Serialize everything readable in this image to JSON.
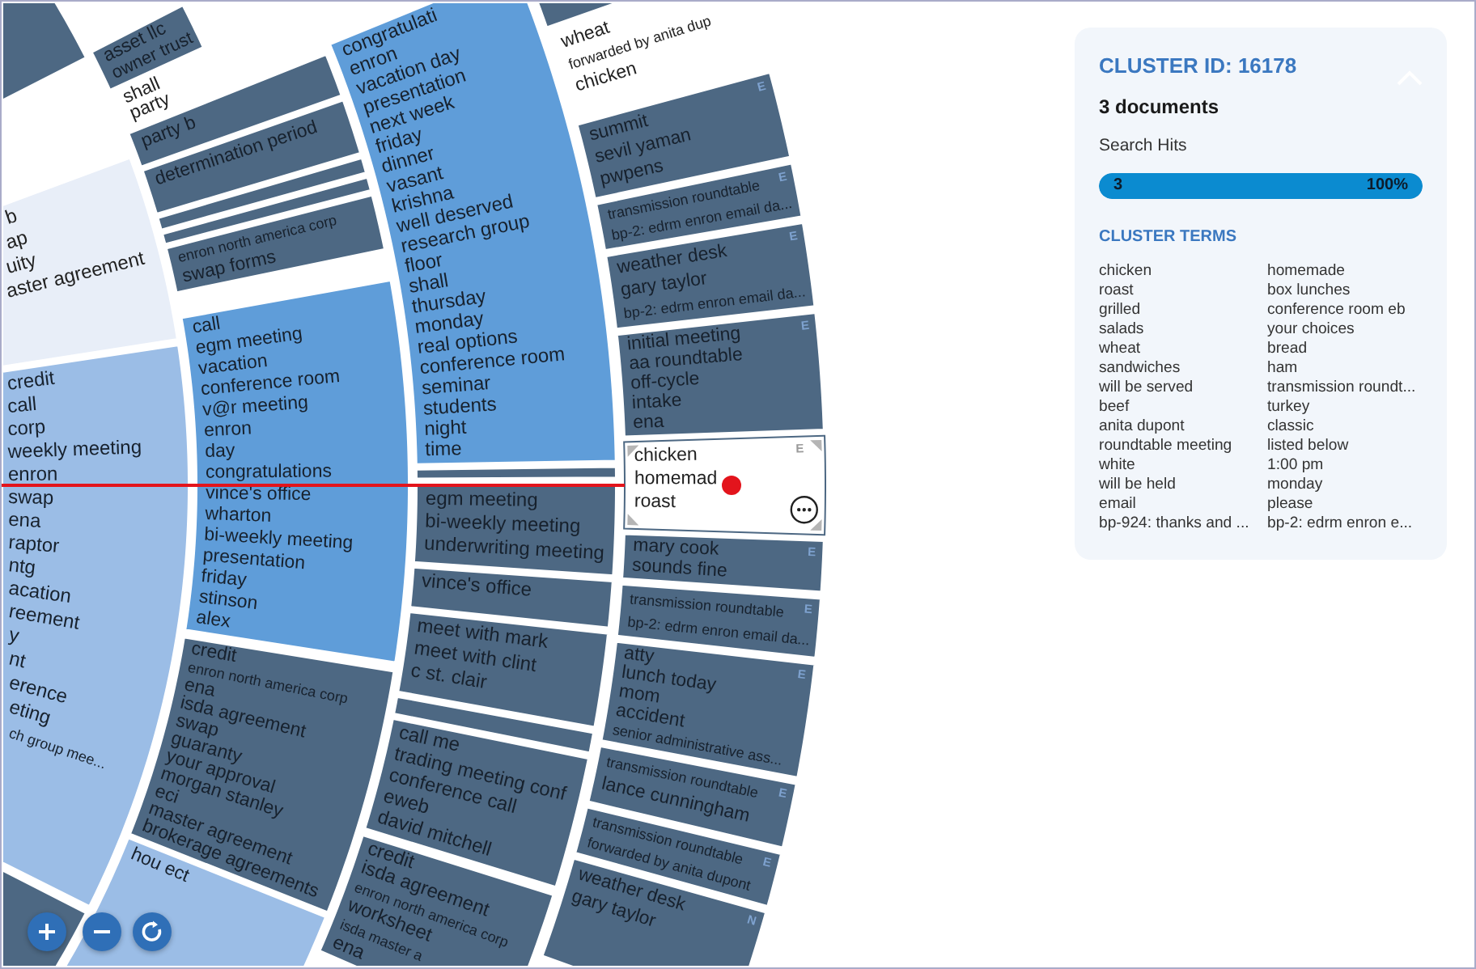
{
  "chart": {
    "rings": [
      {
        "segments": [
          {
            "kind": "dark",
            "selected": false
          },
          {
            "kind": "pale",
            "selected": false,
            "terms": [
              {
                "text": "b",
                "kind": "major"
              },
              {
                "text": "ap",
                "kind": "major"
              },
              {
                "text": "uity",
                "kind": "major"
              },
              {
                "text": "aster agreement",
                "kind": "major"
              }
            ]
          },
          {
            "kind": "light",
            "selected": false,
            "terms": [
              {
                "text": "credit",
                "kind": "major"
              },
              {
                "text": "call",
                "kind": "major"
              },
              {
                "text": "corp",
                "kind": "major"
              },
              {
                "text": "weekly meeting",
                "kind": "major"
              },
              {
                "text": "enron",
                "kind": "major"
              },
              {
                "text": "swap",
                "kind": "major"
              },
              {
                "text": "ena",
                "kind": "major"
              },
              {
                "text": "raptor",
                "kind": "major"
              },
              {
                "text": "ntg",
                "kind": "major"
              },
              {
                "text": "acation",
                "kind": "major"
              },
              {
                "text": "reement",
                "kind": "major"
              },
              {
                "text": "y",
                "kind": "major"
              },
              {
                "text": "nt",
                "kind": "major"
              },
              {
                "text": "erence",
                "kind": "major"
              },
              {
                "text": "eting",
                "kind": "major"
              },
              {
                "text": "ch group mee...",
                "kind": "minor"
              }
            ]
          },
          {
            "kind": "dark",
            "selected": false
          }
        ]
      },
      {
        "segments": [
          {
            "kind": "dark",
            "selected": false,
            "terms": [
              {
                "text": "asset llc",
                "kind": "major"
              },
              {
                "text": "owner trust",
                "kind": "major"
              }
            ]
          },
          {
            "kind": "blank",
            "selected": false,
            "terms": [
              {
                "text": "shall",
                "kind": "major"
              },
              {
                "text": "party",
                "kind": "major"
              }
            ]
          },
          {
            "kind": "dark",
            "selected": false,
            "terms": [
              {
                "text": "party b",
                "kind": "major"
              }
            ]
          },
          {
            "kind": "dark",
            "selected": false,
            "terms": [
              {
                "text": "determination period",
                "kind": "major"
              }
            ]
          },
          {
            "kind": "dark",
            "selected": false
          },
          {
            "kind": "dark",
            "selected": false
          },
          {
            "kind": "dark",
            "selected": false,
            "terms": [
              {
                "text": "enron north america corp",
                "kind": "minor"
              },
              {
                "text": "swap forms",
                "kind": "major"
              }
            ]
          },
          {
            "kind": "medium",
            "selected": false,
            "terms": [
              {
                "text": "call",
                "kind": "major"
              },
              {
                "text": "egm meeting",
                "kind": "major"
              },
              {
                "text": "vacation",
                "kind": "major"
              },
              {
                "text": "conference room",
                "kind": "major"
              },
              {
                "text": "v@r meeting",
                "kind": "major"
              },
              {
                "text": "enron",
                "kind": "major"
              },
              {
                "text": "day",
                "kind": "major"
              },
              {
                "text": "congratulations",
                "kind": "major"
              },
              {
                "text": "vince's office",
                "kind": "major"
              },
              {
                "text": "wharton",
                "kind": "major"
              },
              {
                "text": "bi-weekly meeting",
                "kind": "major"
              },
              {
                "text": "presentation",
                "kind": "major"
              },
              {
                "text": "friday",
                "kind": "major"
              },
              {
                "text": "stinson",
                "kind": "major"
              },
              {
                "text": "alex",
                "kind": "major"
              }
            ]
          },
          {
            "kind": "dark",
            "selected": false,
            "terms": [
              {
                "text": "credit",
                "kind": "major"
              },
              {
                "text": "enron north america corp",
                "kind": "minor"
              },
              {
                "text": "ena",
                "kind": "major"
              },
              {
                "text": "isda agreement",
                "kind": "major"
              },
              {
                "text": "swap",
                "kind": "major"
              },
              {
                "text": "guaranty",
                "kind": "major"
              },
              {
                "text": "your approval",
                "kind": "major"
              },
              {
                "text": "morgan stanley",
                "kind": "major"
              },
              {
                "text": "eci",
                "kind": "major"
              },
              {
                "text": "master agreement",
                "kind": "major"
              },
              {
                "text": "brokerage agreements",
                "kind": "major"
              }
            ]
          },
          {
            "kind": "light",
            "selected": false,
            "terms": [
              {
                "text": "hou ect",
                "kind": "major"
              }
            ]
          }
        ]
      },
      {
        "segments": [
          {
            "kind": "medium",
            "selected": false,
            "terms": [
              {
                "text": "congratulati",
                "kind": "major"
              },
              {
                "text": "enron",
                "kind": "major"
              },
              {
                "text": "vacation day",
                "kind": "major"
              },
              {
                "text": "presentation",
                "kind": "major"
              },
              {
                "text": "next week",
                "kind": "major"
              },
              {
                "text": "friday",
                "kind": "major"
              },
              {
                "text": "dinner",
                "kind": "major"
              },
              {
                "text": "vasant",
                "kind": "major"
              },
              {
                "text": "krishna",
                "kind": "major"
              },
              {
                "text": "well deserved",
                "kind": "major"
              },
              {
                "text": "research group",
                "kind": "major"
              },
              {
                "text": "floor",
                "kind": "major"
              },
              {
                "text": "shall",
                "kind": "major"
              },
              {
                "text": "thursday",
                "kind": "major"
              },
              {
                "text": "monday",
                "kind": "major"
              },
              {
                "text": "real options",
                "kind": "major"
              },
              {
                "text": "conference room",
                "kind": "major"
              },
              {
                "text": "seminar",
                "kind": "major"
              },
              {
                "text": "students",
                "kind": "major"
              },
              {
                "text": "night",
                "kind": "major"
              },
              {
                "text": "time",
                "kind": "major"
              }
            ]
          },
          {
            "kind": "dark",
            "selected": false
          },
          {
            "kind": "dark",
            "selected": false,
            "terms": [
              {
                "text": "egm meeting",
                "kind": "major"
              },
              {
                "text": "bi-weekly meeting",
                "kind": "major"
              },
              {
                "text": "underwriting meeting",
                "kind": "major"
              }
            ]
          },
          {
            "kind": "dark",
            "selected": false,
            "terms": [
              {
                "text": "vince's office",
                "kind": "major"
              }
            ]
          },
          {
            "kind": "dark",
            "selected": false,
            "terms": [
              {
                "text": "meet with mark",
                "kind": "major"
              },
              {
                "text": "meet with clint",
                "kind": "major"
              },
              {
                "text": "c st. clair",
                "kind": "major"
              }
            ]
          },
          {
            "kind": "dark",
            "selected": false
          },
          {
            "kind": "dark",
            "selected": false,
            "terms": [
              {
                "text": "call me",
                "kind": "major"
              },
              {
                "text": "trading meeting conf",
                "kind": "major"
              },
              {
                "text": "conference call",
                "kind": "major"
              },
              {
                "text": "eweb",
                "kind": "major"
              },
              {
                "text": "david mitchell",
                "kind": "major"
              }
            ]
          },
          {
            "kind": "dark",
            "selected": false,
            "terms": [
              {
                "text": "credit",
                "kind": "major"
              },
              {
                "text": "isda agreement",
                "kind": "major"
              },
              {
                "text": "enron north america corp",
                "kind": "minor"
              },
              {
                "text": "worksheet",
                "kind": "major"
              },
              {
                "text": "isda master a",
                "kind": "minor"
              },
              {
                "text": "ena",
                "kind": "major"
              }
            ]
          }
        ]
      },
      {
        "segments": [
          {
            "kind": "dark",
            "selected": false
          },
          {
            "kind": "blank",
            "selected": false,
            "terms": [
              {
                "text": "wheat",
                "kind": "major"
              },
              {
                "text": "forwarded by anita dup",
                "kind": "minor"
              },
              {
                "text": "chicken",
                "kind": "major"
              }
            ]
          },
          {
            "kind": "dark",
            "selected": false,
            "flag": "E",
            "terms": [
              {
                "text": "summit",
                "kind": "major"
              },
              {
                "text": "sevil yaman",
                "kind": "major"
              },
              {
                "text": "pwpens",
                "kind": "major"
              }
            ]
          },
          {
            "kind": "dark",
            "selected": false,
            "flag": "E",
            "terms": [
              {
                "text": "transmission roundtable",
                "kind": "minor"
              },
              {
                "text": "bp-2: edrm enron email da...",
                "kind": "minor"
              }
            ]
          },
          {
            "kind": "dark",
            "selected": false,
            "flag": "E",
            "terms": [
              {
                "text": "weather desk",
                "kind": "major"
              },
              {
                "text": "gary taylor",
                "kind": "major"
              },
              {
                "text": "bp-2: edrm enron email da...",
                "kind": "minor"
              }
            ]
          },
          {
            "kind": "dark",
            "selected": false,
            "flag": "E",
            "terms": [
              {
                "text": "initial meeting",
                "kind": "major"
              },
              {
                "text": "aa roundtable",
                "kind": "major"
              },
              {
                "text": "off-cycle",
                "kind": "major"
              },
              {
                "text": "intake",
                "kind": "major"
              },
              {
                "text": "ena",
                "kind": "major"
              }
            ]
          },
          {
            "kind": "dark",
            "selected": true,
            "flag": "E",
            "terms": [
              {
                "text": "chicken",
                "kind": "major"
              },
              {
                "text": "homemad",
                "kind": "major"
              },
              {
                "text": "roast",
                "kind": "major"
              }
            ]
          },
          {
            "kind": "dark",
            "selected": false,
            "flag": "E",
            "terms": [
              {
                "text": "mary cook",
                "kind": "major"
              },
              {
                "text": "sounds fine",
                "kind": "major"
              }
            ]
          },
          {
            "kind": "dark",
            "selected": false,
            "flag": "E",
            "terms": [
              {
                "text": "transmission roundtable",
                "kind": "minor"
              },
              {
                "text": "bp-2: edrm enron email da...",
                "kind": "minor"
              }
            ]
          },
          {
            "kind": "dark",
            "selected": false,
            "flag": "E",
            "terms": [
              {
                "text": "atty",
                "kind": "major"
              },
              {
                "text": "lunch today",
                "kind": "major"
              },
              {
                "text": "mom",
                "kind": "major"
              },
              {
                "text": "accident",
                "kind": "major"
              },
              {
                "text": "senior administrative ass...",
                "kind": "minor"
              }
            ]
          },
          {
            "kind": "dark",
            "selected": false,
            "flag": "E",
            "terms": [
              {
                "text": "transmission roundtable",
                "kind": "minor"
              },
              {
                "text": "lance cunningham",
                "kind": "major"
              }
            ]
          },
          {
            "kind": "dark",
            "selected": false,
            "flag": "E",
            "terms": [
              {
                "text": "transmission roundtable",
                "kind": "minor"
              },
              {
                "text": "forwarded by anita dupont",
                "kind": "minor"
              }
            ]
          },
          {
            "kind": "dark",
            "selected": false,
            "flag": "N",
            "terms": [
              {
                "text": "weather desk",
                "kind": "major"
              },
              {
                "text": "gary taylor",
                "kind": "major"
              }
            ]
          }
        ]
      }
    ]
  },
  "cluster_panel": {
    "title": "CLUSTER ID: 16178",
    "documents": "3 documents",
    "search_hits": {
      "label": "Search Hits",
      "count": "3",
      "percent": "100%",
      "level": 1
    },
    "terms_heading": "CLUSTER TERMS",
    "terms_columns": [
      [
        "chicken",
        "roast",
        "grilled",
        "salads",
        "wheat",
        "sandwiches",
        "will be served",
        "beef",
        "anita dupont",
        "roundtable meeting",
        "white",
        "will be held",
        "email",
        "bp-924: thanks and ..."
      ],
      [
        "homemade",
        "box lunches",
        "conference room eb",
        "your choices",
        "bread",
        "ham",
        "transmission roundt...",
        "turkey",
        "classic",
        "listed below",
        "1:00 pm",
        "monday",
        "please",
        "bp-2: edrm enron e..."
      ]
    ]
  }
}
